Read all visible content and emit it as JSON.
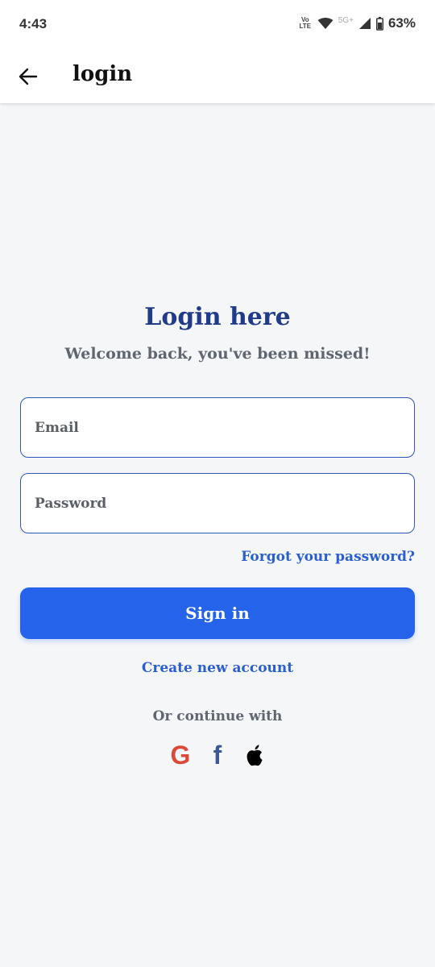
{
  "status_bar": {
    "time": "4:43",
    "volte_line1": "Vo",
    "volte_line2": "LTE",
    "network": "5G+",
    "battery": "63%"
  },
  "app_bar": {
    "title": "login",
    "back_icon": "arrow-left-icon"
  },
  "main": {
    "heading": "Login here",
    "subheading": "Welcome back, you've been missed!",
    "email_placeholder": "Email",
    "password_placeholder": "Password",
    "forgot_link": "Forgot your password?",
    "signin_label": "Sign in",
    "create_account_link": "Create new account",
    "continue_text": "Or continue with",
    "social": [
      {
        "name": "google-icon",
        "glyph": "G",
        "color": "#db4a39"
      },
      {
        "name": "facebook-icon",
        "glyph": "f",
        "color": "#3b5998"
      },
      {
        "name": "apple-icon",
        "color": "#000000"
      }
    ]
  },
  "colors": {
    "accent": "#2563eb",
    "heading": "#1f3b8a",
    "link": "#2a5fd0",
    "background": "#f5f6f8"
  }
}
